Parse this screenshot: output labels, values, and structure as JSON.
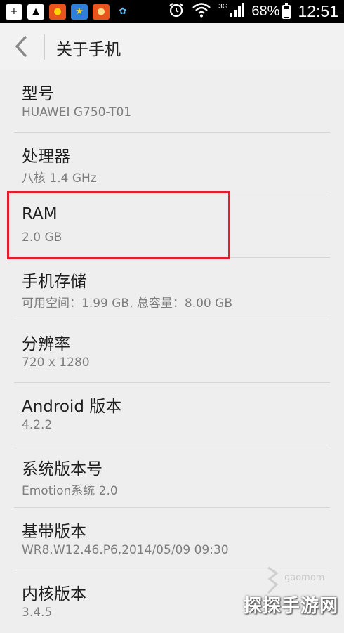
{
  "status_bar": {
    "app_icons": [
      {
        "icon": "add-notification-icon",
        "bg": "#ffffff",
        "fg": "#000000",
        "glyph": "+"
      },
      {
        "icon": "image-notification-icon",
        "bg": "#ffffff",
        "fg": "#000000",
        "glyph": "▲"
      },
      {
        "icon": "game-app-icon",
        "bg": "#e8541c",
        "fg": "#ffd400",
        "glyph": "●"
      },
      {
        "icon": "star-app-icon",
        "bg": "#2f7fd8",
        "fg": "#ffd400",
        "glyph": "★"
      },
      {
        "icon": "bear-app-icon",
        "bg": "#e8541c",
        "fg": "#ffe08a",
        "glyph": "●"
      },
      {
        "icon": "butterfly-app-icon",
        "bg": "#000000",
        "fg": "#5fc3ff",
        "glyph": "✿"
      }
    ],
    "network_label": "3G",
    "battery": "68%",
    "battery_level": 0.68,
    "time": "12:51"
  },
  "action_bar": {
    "title": "关于手机"
  },
  "items": [
    {
      "title": "型号",
      "value": "HUAWEI G750-T01"
    },
    {
      "title": "处理器",
      "value": "八核 1.4 GHz"
    },
    {
      "title": "RAM",
      "value": "2.0 GB"
    },
    {
      "title": "手机存储",
      "value": "可用空间：1.99 GB, 总容量：8.00 GB"
    },
    {
      "title": "分辨率",
      "value": "720 x 1280"
    },
    {
      "title": "Android 版本",
      "value": "4.2.2"
    },
    {
      "title": "系统版本号",
      "value": "Emotion系统 2.0"
    },
    {
      "title": "基带版本",
      "value": "WR8.W12.46.P6,2014/05/09 09:30"
    },
    {
      "title": "内核版本",
      "value": "3.4.5"
    }
  ],
  "highlight_color": "#e21e2c",
  "watermark": {
    "url": "gaomom",
    "text": "探探手游网"
  }
}
